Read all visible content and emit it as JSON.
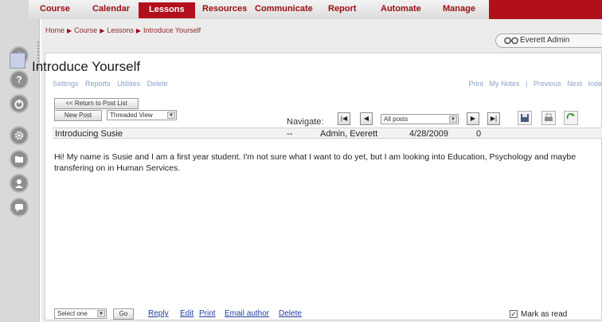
{
  "nav": {
    "items": [
      "Course",
      "Calendar",
      "Lessons",
      "Resources",
      "Communicate",
      "Report",
      "Automate",
      "Manage"
    ],
    "active": "Lessons"
  },
  "breadcrumb": [
    "Home",
    "Course",
    "Lessons",
    "Introduce Yourself"
  ],
  "user": {
    "name": "Everett Admin"
  },
  "page": {
    "title": "Introduce Yourself"
  },
  "toplinks": [
    "Settings",
    "Reports",
    "Utilities",
    "Delete"
  ],
  "rightlinks": [
    "Print",
    "My Notes",
    "|",
    "Previous",
    "Next",
    "Inde"
  ],
  "buttons": {
    "return": "<< Return to Post List",
    "new_post": "New Post",
    "view_select": "Threaded View"
  },
  "navigation": {
    "label": "Navigate:",
    "filter": "All posts",
    "first": "|◀",
    "prev": "◀",
    "next": "▶",
    "last": "▶|"
  },
  "post": {
    "subject": "Introducing Susie",
    "dash": "--",
    "author": "Admin, Everett",
    "date": "4/28/2009",
    "count": "0",
    "body": "Hi!  My name is Susie and I am a first year student.  I'm not sure what I want to do yet, but I am looking into Education, Psychology and maybe transfering on in Human Services."
  },
  "bottom": {
    "select": "Select one",
    "go": "Go",
    "actions": [
      "Reply",
      "Edit",
      "Print",
      "Email author",
      "Delete"
    ],
    "mark_checked": "✓",
    "mark_label": "Mark as read"
  },
  "colors": {
    "brand_red": "#b1101b",
    "link_blue": "#1f3d9e",
    "nav_text": "#9a0d12"
  }
}
